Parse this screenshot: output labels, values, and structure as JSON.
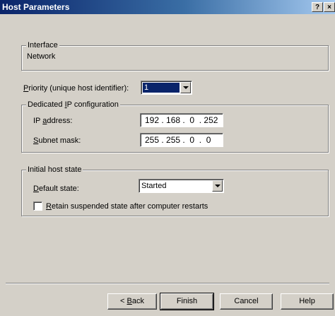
{
  "window": {
    "title": "Host Parameters",
    "help_btn": "?",
    "close_btn": "×"
  },
  "interface": {
    "title": "Interface",
    "value": "Network"
  },
  "priority": {
    "label_u": "P",
    "label_rest": "riority (unique host identifier):",
    "value": "1"
  },
  "dedicated_ip": {
    "title_pre": "Dedicated ",
    "title_u": "I",
    "title_post": "P configuration",
    "ip_label_pre": "IP ",
    "ip_label_u": "a",
    "ip_label_post": "ddress:",
    "ip_value": "192 . 168 .  0  . 252",
    "mask_label_u": "S",
    "mask_label_rest": "ubnet mask:",
    "mask_value": "255 . 255 .  0  .  0"
  },
  "host_state": {
    "title": "Initial host state",
    "default_label_u": "D",
    "default_label_rest": "efault state:",
    "default_value": "Started",
    "retain_u": "R",
    "retain_rest": "etain suspended state after computer restarts",
    "retain_checked": false
  },
  "buttons": {
    "back_pre": "< ",
    "back_u": "B",
    "back_post": "ack",
    "finish": "Finish",
    "cancel": "Cancel",
    "help": "Help"
  }
}
